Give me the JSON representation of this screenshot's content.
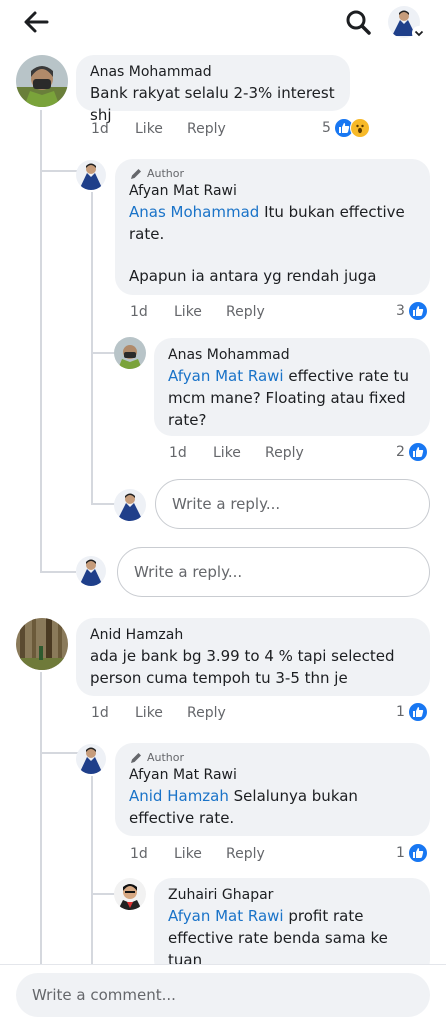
{
  "colors": {
    "mention": "#1a73c8",
    "like_blue": "#1877f2",
    "haha_yellow": "#f7b928",
    "bubble": "#f0f2f5"
  },
  "header": {
    "back_icon": "arrow-left-icon",
    "search_icon": "search-icon"
  },
  "comments": [
    {
      "author": "Anas Mohammad",
      "text": "Bank rakyat selalu 2-3% interest shj",
      "time": "1d",
      "like": "Like",
      "reply": "Reply",
      "reaction_count": "5",
      "replies": [
        {
          "author_tag": "Author",
          "author": "Afyan Mat Rawi",
          "mention": "Anas Mohammad",
          "text_1": " Itu bukan effective",
          "text_2": "rate.",
          "text_3": "Apapun ia antara yg rendah juga",
          "time": "1d",
          "like": "Like",
          "reply": "Reply",
          "reaction_count": "3"
        },
        {
          "author": "Anas Mohammad",
          "mention": "Afyan Mat Rawi",
          "text_1": " effective rate tu",
          "text_2": "mcm mane? Floating atau fixed",
          "text_3": "rate?",
          "time": "1d",
          "like": "Like",
          "reply": "Reply",
          "reaction_count": "2"
        }
      ],
      "nested_reply_placeholder": "Write a reply...",
      "reply_placeholder": "Write a reply..."
    },
    {
      "author": "Anid Hamzah",
      "text_1": "ada je bank bg 3.99 to 4 % tapi selected",
      "text_2": "person cuma tempoh tu 3-5 thn je",
      "time": "1d",
      "like": "Like",
      "reply": "Reply",
      "reaction_count": "1",
      "replies": [
        {
          "author_tag": "Author",
          "author": "Afyan Mat Rawi",
          "mention": "Anid Hamzah",
          "text_1": " Selalunya bukan",
          "text_2": "effective rate.",
          "time": "1d",
          "like": "Like",
          "reply": "Reply",
          "reaction_count": "1"
        },
        {
          "author": "Zuhairi Ghapar",
          "mention": "Afyan Mat Rawi",
          "text_1": " profit rate",
          "text_2": "effective rate benda sama ke",
          "text_3": "tuan"
        }
      ]
    }
  ],
  "footer": {
    "comment_placeholder": "Write a comment..."
  }
}
